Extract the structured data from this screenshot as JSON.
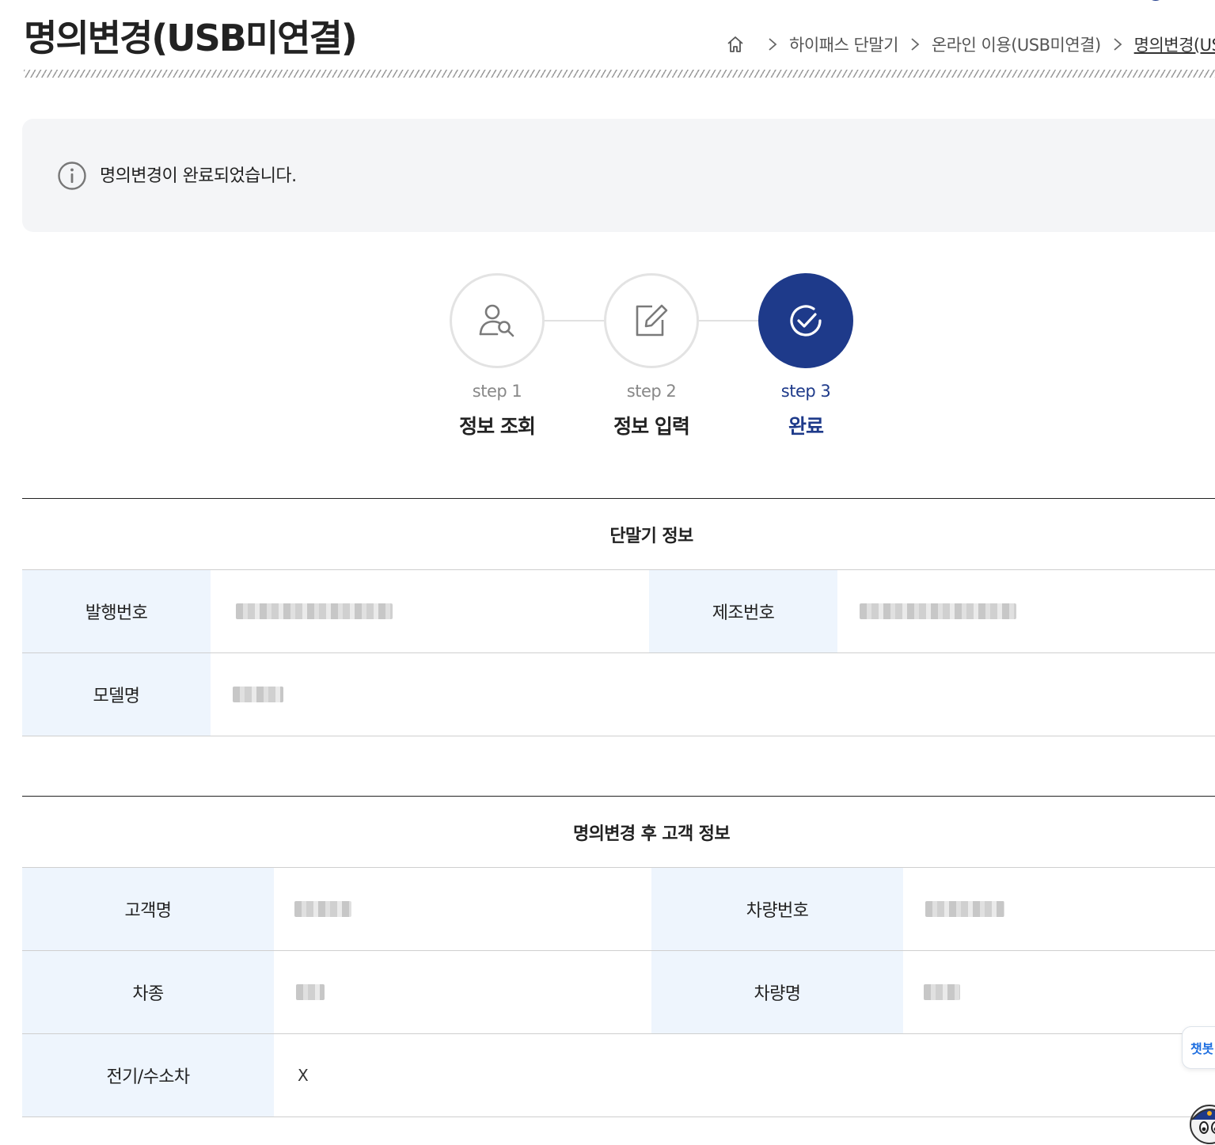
{
  "header": {
    "title": "명의변경(USB미연결)",
    "breadcrumb": [
      "하이패스 단말기",
      "온라인 이용(USB미연결)",
      "명의변경(USB미연결)"
    ]
  },
  "notice": {
    "icon": "info-icon",
    "text": "명의변경이 완료되었습니다."
  },
  "steps": [
    {
      "number": "step 1",
      "label": "정보 조회",
      "icon": "user-search-icon",
      "active": false
    },
    {
      "number": "step 2",
      "label": "정보 입력",
      "icon": "edit-icon",
      "active": false
    },
    {
      "number": "step 3",
      "label": "완료",
      "icon": "check-circle-icon",
      "active": true
    }
  ],
  "terminal_info": {
    "title": "단말기 정보",
    "fields": [
      {
        "label": "발행번호",
        "value": ""
      },
      {
        "label": "제조번호",
        "value": ""
      },
      {
        "label": "모델명",
        "value": ""
      }
    ]
  },
  "customer_info": {
    "title": "명의변경 후 고객 정보",
    "fields": [
      {
        "label": "고객명",
        "value": ""
      },
      {
        "label": "차량번호",
        "value": ""
      },
      {
        "label": "차종",
        "value": ""
      },
      {
        "label": "차량명",
        "value": ""
      },
      {
        "label": "전기/수소차",
        "value": "X"
      }
    ]
  },
  "floating": {
    "chatbot_label": "챗봇",
    "mascot_icon": "mascot-icon"
  },
  "colors": {
    "primary": "#1e3a8a",
    "header_cell": "#eef5fd",
    "notice_bg": "#f4f5f7",
    "chatbot": "#1f6fe0"
  }
}
